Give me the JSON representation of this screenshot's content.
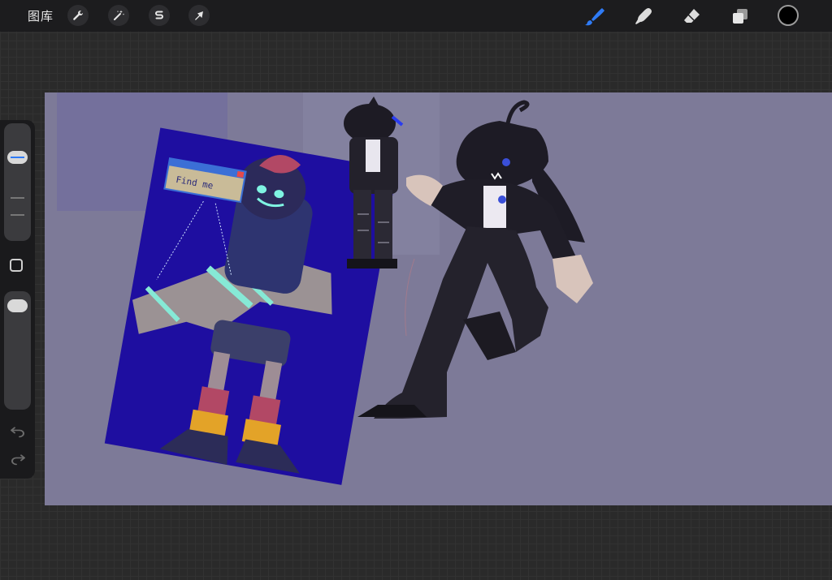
{
  "toolbar": {
    "gallery_label": "图库",
    "actions_icon": "wrench-icon",
    "adjustments_icon": "magic-wand-icon",
    "selection_icon": "selection-s-icon",
    "transform_icon": "arrow-cursor-icon",
    "brush_icon": "brush-icon",
    "smudge_icon": "smudge-finger-icon",
    "eraser_icon": "eraser-icon",
    "layers_icon": "layers-icon",
    "active_tool": "brush",
    "active_color": "#000000",
    "accent_color": "#2f7bf5"
  },
  "sidebar": {
    "brush_size_level": 0.25,
    "opacity_level": 0.05,
    "undo_icon": "undo-icon",
    "redo_icon": "redo-icon"
  },
  "artwork": {
    "window_popup_text": "Find me",
    "canvas_color": "#7d7a98",
    "poster_color": "#1e0ea0"
  }
}
